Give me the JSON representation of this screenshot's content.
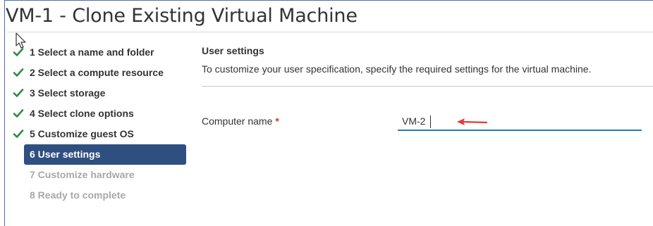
{
  "window": {
    "title": "VM-1 - Clone Existing Virtual Machine"
  },
  "wizard": {
    "steps": [
      {
        "label": "1 Select a name and folder",
        "state": "done"
      },
      {
        "label": "2 Select a compute resource",
        "state": "done"
      },
      {
        "label": "3 Select storage",
        "state": "done"
      },
      {
        "label": "4 Select clone options",
        "state": "done"
      },
      {
        "label": "5 Customize guest OS",
        "state": "done"
      },
      {
        "label": "6 User settings",
        "state": "active"
      },
      {
        "label": "7 Customize hardware",
        "state": "todo"
      },
      {
        "label": "8 Ready to complete",
        "state": "todo"
      }
    ]
  },
  "main": {
    "section_title": "User settings",
    "section_description": "To customize your user specification, specify the required settings for the virtual machine.",
    "computer_name": {
      "label": "Computer name",
      "required_marker": "*",
      "value": "VM-2"
    }
  },
  "colors": {
    "accent": "#2f4f80",
    "check": "#2e8b3d",
    "required": "#d03a2b",
    "input_underline": "#2a79b8",
    "annotation_arrow": "#e03a3a"
  }
}
